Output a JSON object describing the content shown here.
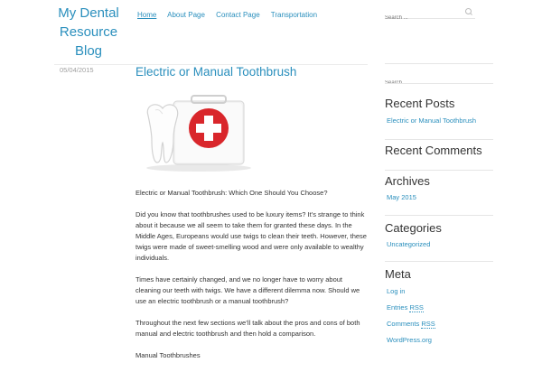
{
  "site": {
    "title_line1": "My Dental",
    "title_line2": "Resource",
    "title_line3": "Blog"
  },
  "nav": {
    "items": [
      {
        "label": "Home"
      },
      {
        "label": "About Page"
      },
      {
        "label": "Contact Page"
      },
      {
        "label": "Transportation"
      }
    ]
  },
  "header_search": {
    "placeholder": "Search ..."
  },
  "post": {
    "date": "05/04/2015",
    "title": "Electric or Manual Toothbrush",
    "paragraphs": [
      "Electric or Manual Toothbrush: Which One Should You Choose?",
      "Did you know that toothbrushes used to be luxury items? It’s strange to think about it because we all seem to take them for granted these days. In the Middle Ages, Europeans would use twigs to clean their teeth. However, these twigs were made of sweet-smelling wood and were only available to wealthy individuals.",
      "Times have certainly changed, and we no longer have to worry about cleaning our teeth with twigs. We have a different dilemma now. Should we use an electric toothbrush or a manual toothbrush?",
      "Throughout the next few sections we’ll talk about the pros and cons of both manual and electric toothbrush and then hold a comparison.",
      "Manual Toothbrushes"
    ]
  },
  "sidebar": {
    "search_placeholder": "Search ...",
    "recent_posts": {
      "title": "Recent Posts",
      "items": [
        "Electric or Manual Toothbrush"
      ]
    },
    "recent_comments": {
      "title": "Recent Comments"
    },
    "archives": {
      "title": "Archives",
      "items": [
        "May 2015"
      ]
    },
    "categories": {
      "title": "Categories",
      "items": [
        "Uncategorized"
      ]
    },
    "meta": {
      "title": "Meta",
      "login": "Log in",
      "entries_prefix": "Entries ",
      "comments_prefix": "Comments ",
      "rss": "RSS",
      "wordpress": "WordPress.org"
    }
  },
  "colors": {
    "accent": "#2a8fbd",
    "text": "#333333",
    "muted": "#a0a0a0",
    "kit_red": "#d9262b"
  }
}
